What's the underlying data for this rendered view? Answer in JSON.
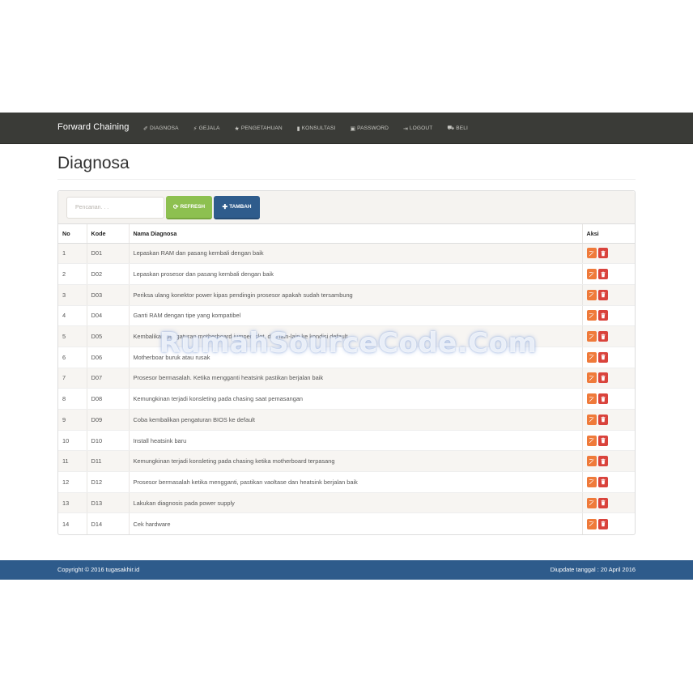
{
  "navbar": {
    "brand": "Forward Chaining",
    "items": [
      {
        "icon": "pin-icon",
        "glyph": "✐",
        "label": "DIAGNOSA"
      },
      {
        "icon": "bolt-icon",
        "glyph": "⚡",
        "label": "GEJALA"
      },
      {
        "icon": "star-icon",
        "glyph": "★",
        "label": "PENGETAHUAN"
      },
      {
        "icon": "bar-chart-icon",
        "glyph": "▮",
        "label": "KONSULTASI"
      },
      {
        "icon": "lock-icon",
        "glyph": "▣",
        "label": "PASSWORD"
      },
      {
        "icon": "logout-icon",
        "glyph": "⇥",
        "label": "LOGOUT"
      },
      {
        "icon": "cart-icon",
        "glyph": "⛟",
        "label": "BELI"
      }
    ]
  },
  "page": {
    "title": "Diagnosa"
  },
  "toolbar": {
    "search_placeholder": "Pencarian. . .",
    "search_value": "",
    "refresh_label": "REFRESH",
    "add_label": "TAMBAH"
  },
  "table": {
    "headers": {
      "no": "No",
      "kode": "Kode",
      "nama": "Nama Diagnosa",
      "aksi": "Aksi"
    },
    "rows": [
      {
        "no": "1",
        "kode": "D01",
        "nama": "Lepaskan RAM dan pasang kembali dengan baik"
      },
      {
        "no": "2",
        "kode": "D02",
        "nama": "Lepaskan prosesor dan pasang kembali dengan baik"
      },
      {
        "no": "3",
        "kode": "D03",
        "nama": "Periksa ulang konektor power kipas pendingin prosesor apakah sudah tersambung"
      },
      {
        "no": "4",
        "kode": "D04",
        "nama": "Ganti RAM dengan tipe yang kompatibel"
      },
      {
        "no": "5",
        "kode": "D05",
        "nama": "Kembalikan pengaturan motherboard jumper, slot, dan lain-lain ke kondisi default"
      },
      {
        "no": "6",
        "kode": "D06",
        "nama": "Motherboar buruk atau rusak"
      },
      {
        "no": "7",
        "kode": "D07",
        "nama": "Prosesor bermasalah. Ketika mengganti heatsink pastikan berjalan baik"
      },
      {
        "no": "8",
        "kode": "D08",
        "nama": "Kemungkinan terjadi konsleting pada chasing saat pemasangan"
      },
      {
        "no": "9",
        "kode": "D09",
        "nama": "Coba kembalikan pengaturan BIOS ke default"
      },
      {
        "no": "10",
        "kode": "D10",
        "nama": "Install heatsink baru"
      },
      {
        "no": "11",
        "kode": "D11",
        "nama": "Kemungkinan terjadi konsleting pada chasing ketika motherboard terpasang"
      },
      {
        "no": "12",
        "kode": "D12",
        "nama": "Prosesor bermasalah ketika mengganti, pastikan vaoltase dan heatsink berjalan baik"
      },
      {
        "no": "13",
        "kode": "D13",
        "nama": "Lakukan diagnosis pada power supply"
      },
      {
        "no": "14",
        "kode": "D14",
        "nama": "Cek hardware"
      }
    ]
  },
  "watermark": "RumahSourceCode.Com",
  "footer": {
    "copyright": "Copyright © 2016 tugasakhir.id",
    "updated": "Diupdate tanggal : 20 April 2016"
  },
  "colors": {
    "navbar": "#3a3b37",
    "refresh": "#8dc050",
    "tambah": "#2f5c8c",
    "edit": "#ef7a3a",
    "delete": "#d9433c",
    "footer": "#2e5b8b"
  }
}
